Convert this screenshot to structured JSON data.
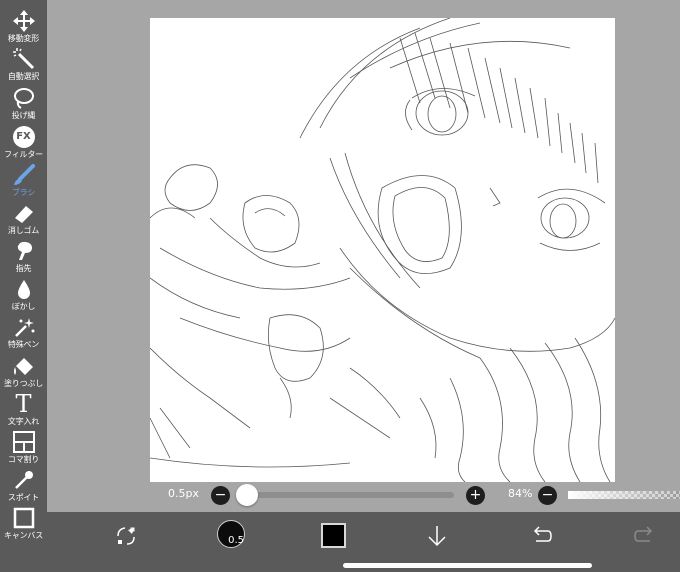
{
  "toolbar": {
    "tools": [
      {
        "label": "移動変形",
        "icon": "move-arrows-icon"
      },
      {
        "label": "自動選択",
        "icon": "magic-wand-icon"
      },
      {
        "label": "投げ縄",
        "icon": "lasso-icon"
      },
      {
        "label": "フィルター",
        "icon": "fx-icon",
        "icon_text": "FX"
      },
      {
        "label": "ブラシ",
        "icon": "brush-icon",
        "active": true
      },
      {
        "label": "消しゴム",
        "icon": "eraser-icon"
      },
      {
        "label": "指先",
        "icon": "smudge-finger-icon"
      },
      {
        "label": "ぼかし",
        "icon": "blur-drop-icon"
      },
      {
        "label": "特殊ペン",
        "icon": "special-pen-icon"
      },
      {
        "label": "塗りつぶし",
        "icon": "bucket-fill-icon"
      },
      {
        "label": "文字入れ",
        "icon": "text-icon",
        "icon_text": "T"
      },
      {
        "label": "コマ割り",
        "icon": "frame-divider-icon"
      },
      {
        "label": "スポイト",
        "icon": "eyedropper-icon"
      },
      {
        "label": "キャンバス",
        "icon": "canvas-icon"
      }
    ],
    "active_color": "#6fa3e8"
  },
  "slider": {
    "brush_size_label": "0.5px",
    "minus": "−",
    "plus": "+",
    "zoom_label": "84%",
    "zoom_minus": "−",
    "value_fraction": 0.0
  },
  "bottombar": {
    "icons": [
      "swap-color-icon",
      "brush-size-icon",
      "color-swatch-icon",
      "layer-down-arrow-icon",
      "undo-icon",
      "redo-icon"
    ],
    "brush_size_value": "0.5",
    "current_color": "#000000"
  }
}
